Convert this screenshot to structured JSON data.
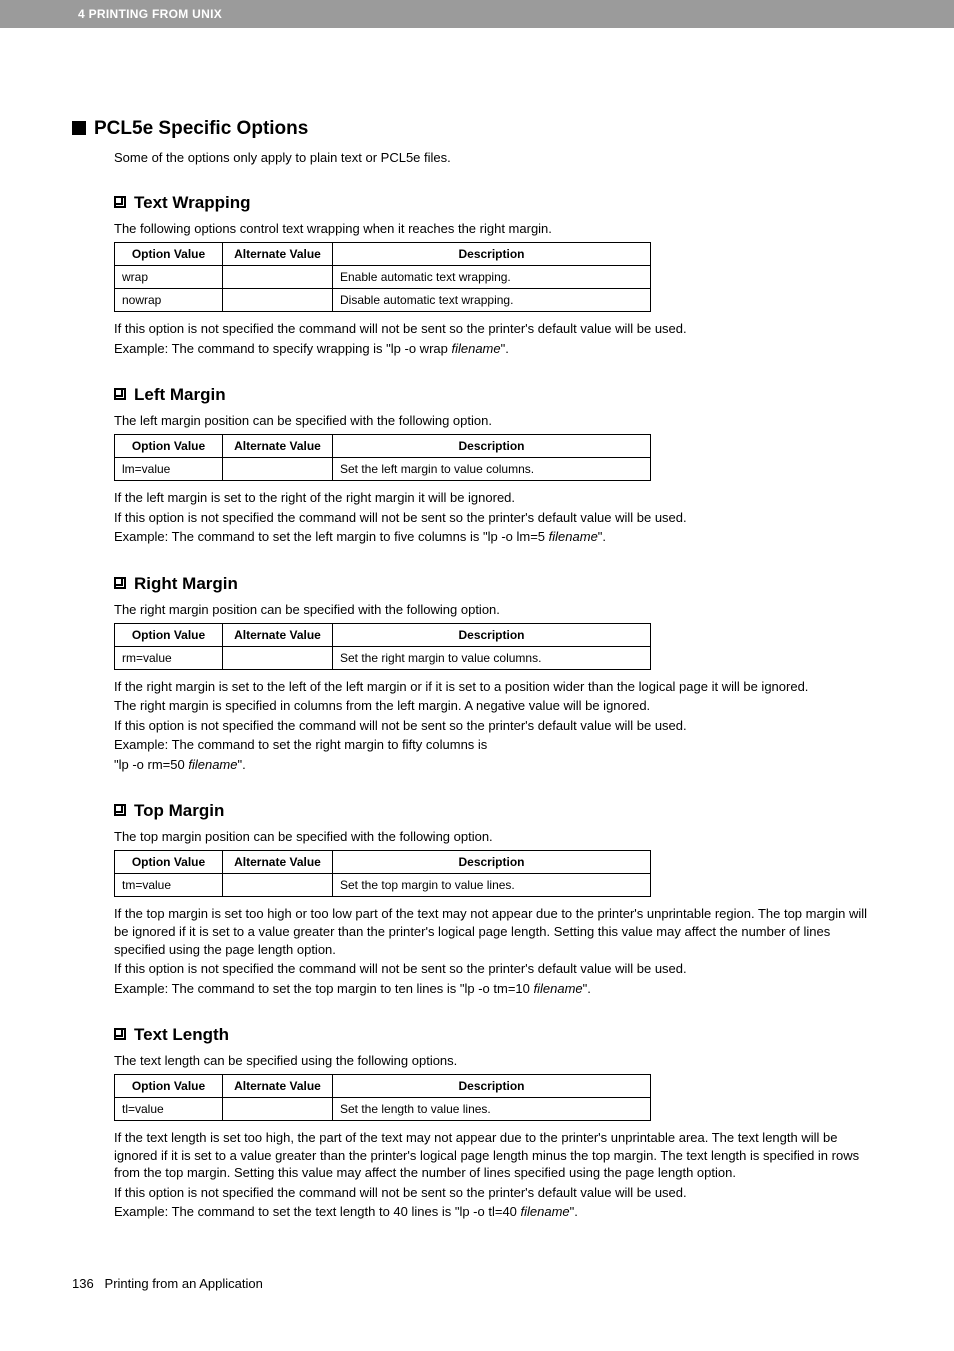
{
  "header": {
    "breadcrumb": "4 PRINTING FROM UNIX"
  },
  "main": {
    "title": "PCL5e Specific Options",
    "intro": "Some of the options only apply to plain text or PCL5e files.",
    "th_option": "Option Value",
    "th_alternate": "Alternate Value",
    "th_description": "Description",
    "sections": {
      "textwrap": {
        "title": "Text Wrapping",
        "desc": "The following options control text wrapping when it reaches the right margin.",
        "rows": [
          {
            "opt": "wrap",
            "alt": "",
            "d": "Enable automatic text wrapping."
          },
          {
            "opt": "nowrap",
            "alt": "",
            "d": "Disable automatic text wrapping."
          }
        ],
        "note1": "If this option is not specified the command will not be sent so the printer's default value will be used.",
        "note2a": "Example: The command to specify wrapping is \"lp -o wrap ",
        "note2b": "filename",
        "note2c": "\"."
      },
      "leftmargin": {
        "title": "Left Margin",
        "desc": "The left margin position can be specified with the following option.",
        "rows": [
          {
            "opt": "lm=value",
            "alt": "",
            "d": "Set the left margin to value columns."
          }
        ],
        "note1": "If the left margin is set to the right of the right margin it will be ignored.",
        "note2": "If this option is not specified the command will not be sent so the printer's default value will be used.",
        "note3a": "Example: The command to set the left margin to five columns is \"lp -o lm=5 ",
        "note3b": "filename",
        "note3c": "\"."
      },
      "rightmargin": {
        "title": "Right Margin",
        "desc": "The right margin position can be specified with the following option.",
        "rows": [
          {
            "opt": "rm=value",
            "alt": "",
            "d": "Set the right margin to value columns."
          }
        ],
        "note1": "If the right margin is set to the left of the left margin or if it is set to a position wider than the logical page it will be ignored.",
        "note2": "The right margin is specified in columns from the left margin. A negative value will be ignored.",
        "note3": "If this option is not specified the command will not be sent so the printer's default value will be used.",
        "note4": "Example: The command to set the right margin to fifty columns is",
        "note5a": "\"lp -o rm=50 ",
        "note5b": "filename",
        "note5c": "\"."
      },
      "topmargin": {
        "title": "Top Margin",
        "desc": "The top margin position can be specified with the following option.",
        "rows": [
          {
            "opt": "tm=value",
            "alt": "",
            "d": "Set the top margin to value lines."
          }
        ],
        "note1": "If the top margin is set too high or too low part of the text may not appear due to the printer's unprintable region. The top margin will be ignored if it is set to a value greater than the printer's logical page length. Setting this value may affect the number of lines specified using the page length option.",
        "note2": "If this option is not specified the command will not be sent so the printer's default value will be used.",
        "note3a": "Example: The command to set the top margin to ten lines is \"lp -o tm=10 ",
        "note3b": "filename",
        "note3c": "\"."
      },
      "textlength": {
        "title": "Text Length",
        "desc": "The text length can be specified using the following options.",
        "rows": [
          {
            "opt": "tl=value",
            "alt": "",
            "d": "Set the length to value lines."
          }
        ],
        "note1": "If the text length is set too high, the part of the text may not appear due to the printer's unprintable area.  The text length will be ignored if it is set to a value greater than the printer's logical page length minus the top margin.  The text length is specified in rows from the top margin.  Setting this value may affect the number of lines specified using the page length option.",
        "note2": "If this option is not specified the command will not be sent so the printer's default value will be used.",
        "note3a": "Example: The command to set the text length to 40 lines is \"lp -o tl=40 ",
        "note3b": "filename",
        "note3c": "\"."
      }
    }
  },
  "footer": {
    "page_number": "136",
    "section_label": "Printing from an Application"
  }
}
